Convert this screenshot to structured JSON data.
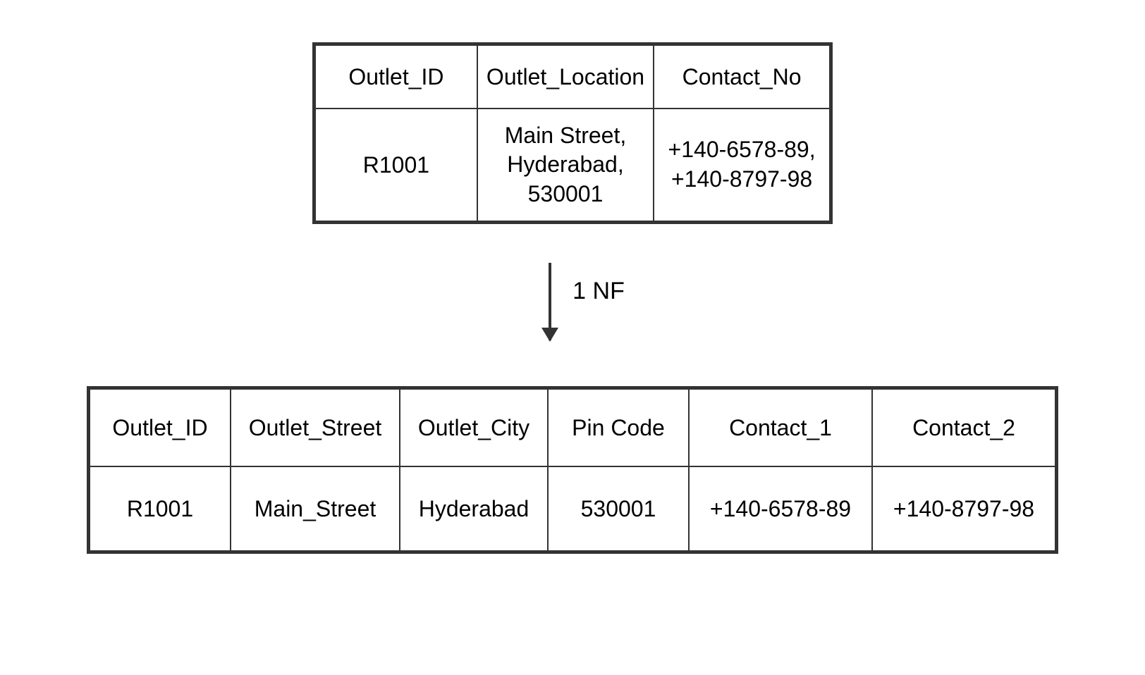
{
  "table1": {
    "headers": [
      "Outlet_ID",
      "Outlet_Location",
      "Contact_No"
    ],
    "row": {
      "outlet_id": "R1001",
      "outlet_location": "Main Street,\nHyderabad,\n530001",
      "contact_no": "+140-6578-89,\n+140-8797-98"
    }
  },
  "arrow_label": "1 NF",
  "table2": {
    "headers": [
      "Outlet_ID",
      "Outlet_Street",
      "Outlet_City",
      "Pin Code",
      "Contact_1",
      "Contact_2"
    ],
    "row": {
      "outlet_id": "R1001",
      "outlet_street": "Main_Street",
      "outlet_city": "Hyderabad",
      "pin_code": "530001",
      "contact_1": "+140-6578-89",
      "contact_2": "+140-8797-98"
    }
  }
}
